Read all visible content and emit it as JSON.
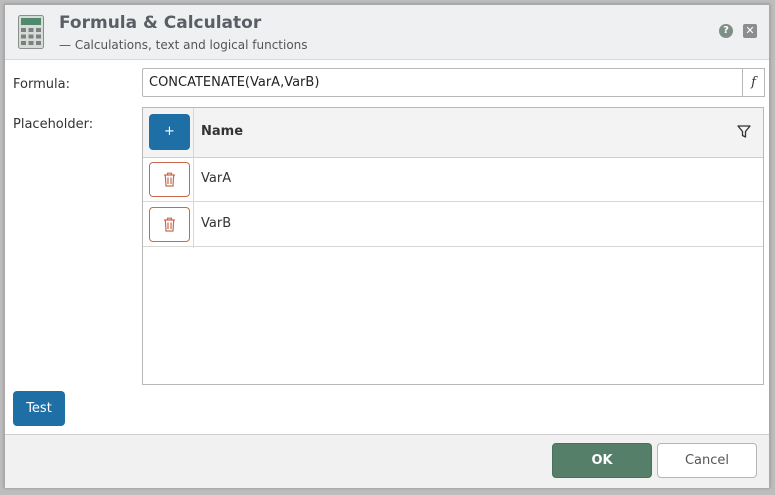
{
  "dialog": {
    "title": "Formula & Calculator",
    "subtitle": "— Calculations, text and logical functions",
    "help_glyph": "?",
    "close_glyph": "✕"
  },
  "form": {
    "formula_label": "Formula:",
    "formula_value": "CONCATENATE(VarA,VarB)",
    "fx_glyph": "f",
    "placeholder_label": "Placeholder:"
  },
  "placeholder_grid": {
    "add_glyph": "+",
    "column_name": "Name",
    "rows": [
      {
        "name": "VarA"
      },
      {
        "name": "VarB"
      }
    ]
  },
  "buttons": {
    "test": "Test",
    "ok": "OK",
    "cancel": "Cancel"
  },
  "icons": {
    "header": "calculator-icon",
    "help": "help-icon",
    "close": "close-icon",
    "filter": "filter-icon",
    "delete": "trash-icon"
  },
  "colors": {
    "primary": "#1f6fa7",
    "ok": "#557f68",
    "delete_border": "#c96a4f",
    "header_bg": "#eef0f2"
  }
}
